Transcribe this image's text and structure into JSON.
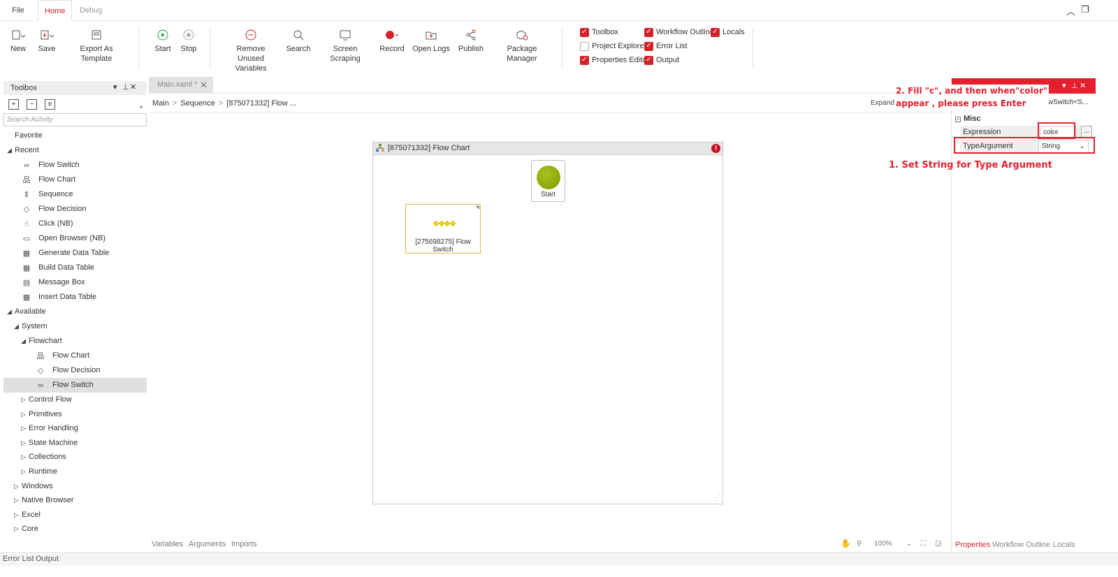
{
  "menu_tabs": [
    "File",
    "Home",
    "Debug"
  ],
  "ribbon": {
    "new": "New",
    "save": "Save",
    "export_template": "Export As Template",
    "start": "Start",
    "stop": "Stop",
    "remove_unused_1": "Remove Unused",
    "remove_unused_2": "Variables",
    "search": "Search",
    "screen_scraping": "Screen Scraping",
    "record": "Record",
    "open_logs": "Open Logs",
    "publish": "Publish",
    "package_manager": "Package Manager"
  },
  "panels_toggles": {
    "toolbox": {
      "label": "Toolbox",
      "checked": true
    },
    "workflow_outline": {
      "label": "Workflow Outline",
      "checked": true
    },
    "locals": {
      "label": "Locals",
      "checked": true
    },
    "project_explorer": {
      "label": "Project Explorer",
      "checked": false
    },
    "error_list": {
      "label": "Error List",
      "checked": true
    },
    "properties_editor": {
      "label": "Properties Editor",
      "checked": true
    },
    "output": {
      "label": "Output",
      "checked": true
    }
  },
  "toolbox": {
    "title": "Toolbox",
    "search_placeholder": "Search Activity",
    "items": [
      {
        "label": "Favorite",
        "tw": ""
      },
      {
        "label": "Recent",
        "tw": "◢"
      },
      {
        "label": "Flow Switch",
        "icon": "∞"
      },
      {
        "label": "Flow Chart",
        "icon": "品"
      },
      {
        "label": "Sequence",
        "icon": "⇕"
      },
      {
        "label": "Flow Decision",
        "icon": "◇"
      },
      {
        "label": "Click (NB)",
        "icon": "☝"
      },
      {
        "label": "Open Browser (NB)",
        "icon": "▭"
      },
      {
        "label": "Generate Data Table",
        "icon": "▦"
      },
      {
        "label": "Build Data Table",
        "icon": "▦"
      },
      {
        "label": "Message Box",
        "icon": "▤"
      },
      {
        "label": "Insert Data Table",
        "icon": "▦"
      },
      {
        "label": "Available",
        "tw": "◢"
      },
      {
        "label": "System",
        "tw": "◢"
      },
      {
        "label": "Flowchart",
        "tw": "◢"
      },
      {
        "label": "Flow Chart",
        "icon": "品"
      },
      {
        "label": "Flow Decision",
        "icon": "◇"
      },
      {
        "label": "Flow Switch",
        "icon": "∞"
      },
      {
        "label": "Control Flow",
        "tw": "▷"
      },
      {
        "label": "Primitives",
        "tw": "▷"
      },
      {
        "label": "Error Handling",
        "tw": "▷"
      },
      {
        "label": "State Machine",
        "tw": "▷"
      },
      {
        "label": "Collections",
        "tw": "▷"
      },
      {
        "label": "Runtime",
        "tw": "▷"
      },
      {
        "label": "Windows",
        "tw": "▷"
      },
      {
        "label": "Native Browser",
        "tw": "▷"
      },
      {
        "label": "Excel",
        "tw": "▷"
      },
      {
        "label": "Core",
        "tw": "▷"
      }
    ]
  },
  "document": {
    "tab": "Main.xaml *",
    "breadcrumb": [
      "Main",
      "Sequence",
      "[875071332] Flow ..."
    ],
    "expand": "Expand A",
    "flowchart_title": "[875071332] Flow Chart",
    "start_label": "Start",
    "switch_label": "[275698275] Flow Switch",
    "bottom_tabs": [
      "Variables",
      "Arguments",
      "Imports"
    ],
    "zoom": "100%"
  },
  "properties": {
    "type_label": "lowSwitch<S...",
    "category": "Misc",
    "expression_label": "Expression",
    "expression_value": "color",
    "type_argument_label": "TypeArgument",
    "type_argument_value": "String",
    "ellipsis": "...",
    "tabs": [
      "Properties",
      "Workflow Outline",
      "Locals"
    ]
  },
  "annotations": {
    "step2_line1": "2. Fill \"c\", and then when\"color\"",
    "step2_line2": "appear , please press Enter",
    "step1": "1. Set String for Type Argument"
  },
  "statusbar": [
    "Error List",
    "Output"
  ],
  "colors": {
    "accent": "#d2232a",
    "annotation": "#e5202e"
  }
}
